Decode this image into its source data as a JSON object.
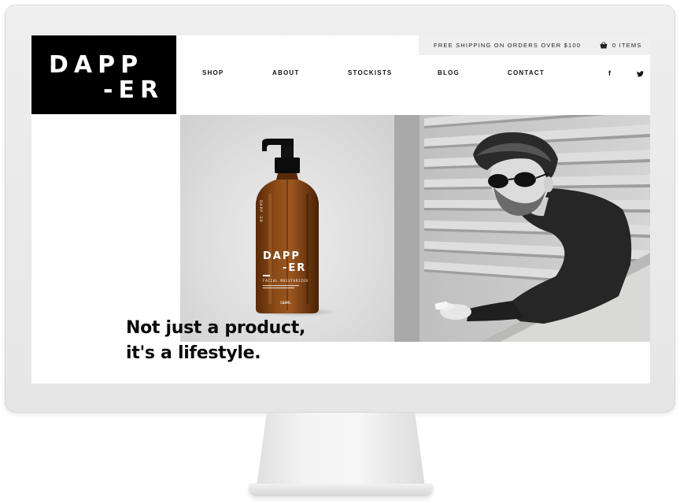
{
  "logo": {
    "line1": "DAPP",
    "line2": "-ER"
  },
  "promo": {
    "shipping_text": "FREE SHIPPING ON ORDERS OVER $100",
    "cart_text": "0 ITEMS",
    "cart_icon": "shopping-basket-icon"
  },
  "nav": {
    "items": [
      {
        "label": "SHOP"
      },
      {
        "label": "ABOUT"
      },
      {
        "label": "STOCKISTS"
      },
      {
        "label": "BLOG"
      },
      {
        "label": "CONTACT"
      }
    ]
  },
  "social": {
    "facebook": "f",
    "twitter": "twitter-bird-icon"
  },
  "product": {
    "brand_line1": "DAPP",
    "brand_line2": "-ER",
    "side_label": "DAPP -ER",
    "subtitle": "FACIAL MOISTURIZER",
    "volume": "500ML"
  },
  "hero": {
    "tagline_line1": "Not just a product,",
    "tagline_line2": "it's a lifestyle."
  },
  "colors": {
    "logo_bg": "#000000",
    "promo_bg": "#efefef",
    "bottle": "#7a3d10",
    "text": "#0a0a0a"
  }
}
